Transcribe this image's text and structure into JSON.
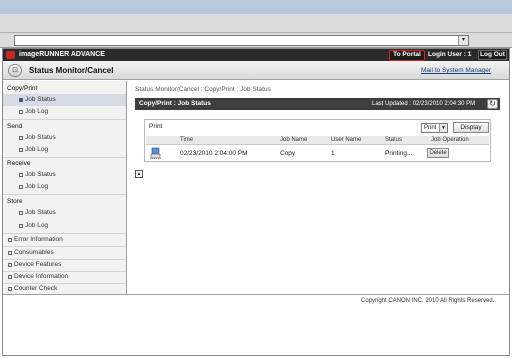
{
  "header": {
    "brand": "imageRUNNER ADVANCE",
    "portal_label": "To Portal",
    "login_user": "Login User : 1",
    "logout_label": "Log Out"
  },
  "title_bar": {
    "icon_text": "⊡",
    "title": "Status Monitor/Cancel",
    "mail_link": "Mail to System Manager"
  },
  "sidebar": {
    "groups": [
      {
        "label": "Copy/Print",
        "items": [
          "Job Status",
          "Job Log"
        ]
      },
      {
        "label": "Send",
        "items": [
          "Job Status",
          "Job Log"
        ]
      },
      {
        "label": "Receive",
        "items": [
          "Job Status",
          "Job Log"
        ]
      },
      {
        "label": "Store",
        "items": [
          "Job Status",
          "Job Log"
        ]
      }
    ],
    "active": "Copy/Print > Job Status",
    "links": [
      "Error Information",
      "Consumables",
      "Device Features",
      "Device Information",
      "Counter Check"
    ]
  },
  "main": {
    "breadcrumb": "Status Monitor/Cancel : Copy/Print : Job Status",
    "panel_title": "Copy/Print : Job Status",
    "last_updated": "Last Updated : 02/23/2010 2:04:30 PM",
    "filter_label": "Print",
    "filter_value": "Print",
    "display_label": "Display",
    "columns": [
      "Time",
      "Job Name",
      "User Name",
      "Status",
      "Job Operation"
    ],
    "rows": [
      {
        "time": "02/23/2010 2:04:00 PM",
        "job_name": "Copy",
        "user_name": "1",
        "status": "Printing...",
        "operation": "Delete"
      }
    ]
  },
  "footer": {
    "copyright": "Copyright CANON INC. 2010 All Rights Reserved."
  },
  "colors": {
    "brand_bar": "#2a2a2a",
    "portal_border": "#e02020",
    "panel_head": "#3e3e3e",
    "active_item": "#d6dce6"
  }
}
